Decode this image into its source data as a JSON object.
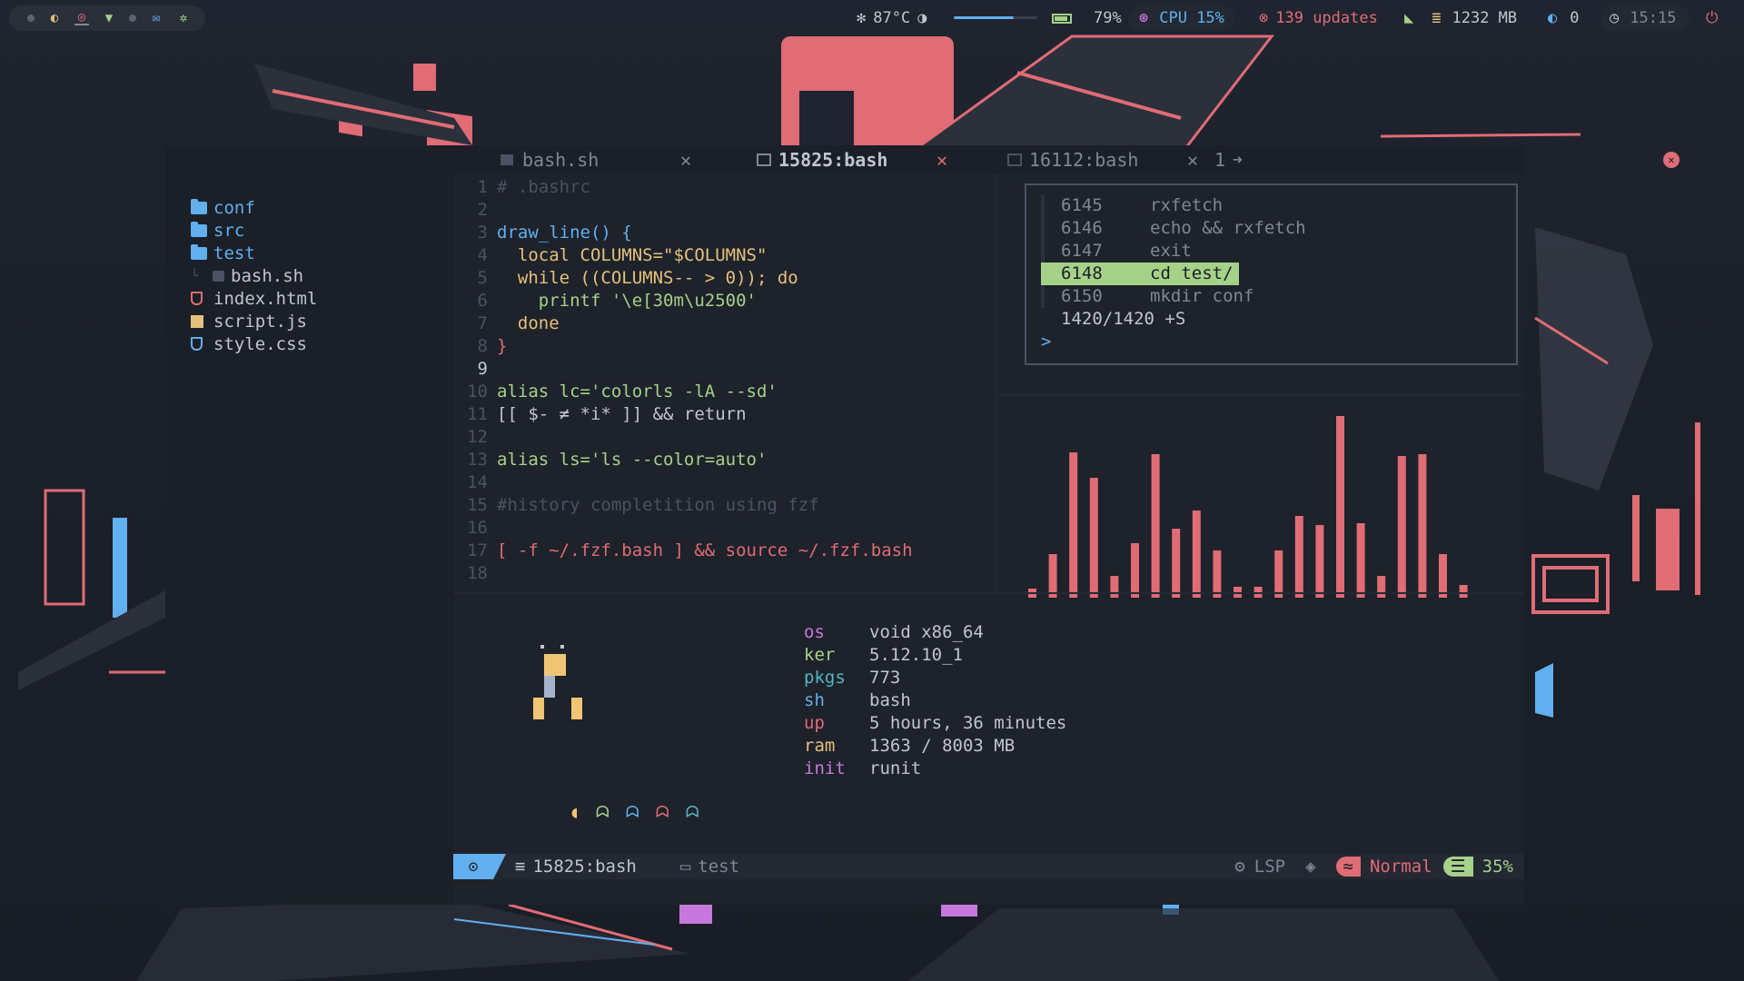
{
  "topbar": {
    "temperature": "87°C",
    "brightness": 0.72,
    "battery": "79%",
    "cpu": "CPU 15%",
    "updates": "139 updates",
    "memory": "1232 MB",
    "notifications": "0",
    "time": "15:15"
  },
  "file_tree": {
    "items": [
      {
        "label": "conf",
        "type": "folder"
      },
      {
        "label": "src",
        "type": "folder"
      },
      {
        "label": "test",
        "type": "folder"
      },
      {
        "label": "bash.sh",
        "type": "file"
      },
      {
        "label": "index.html",
        "type": "file"
      },
      {
        "label": "script.js",
        "type": "file"
      },
      {
        "label": "style.css",
        "type": "file"
      }
    ]
  },
  "tabs": [
    {
      "label": "bash.sh",
      "active": false
    },
    {
      "label": "15825:bash",
      "active": true
    },
    {
      "label": "16112:bash",
      "active": false
    }
  ],
  "tab_extra": "1",
  "editor": {
    "lines": [
      {
        "n": "1",
        "text": "# .bashrc"
      },
      {
        "n": "2",
        "text": ""
      },
      {
        "n": "3",
        "text": "draw_line() {"
      },
      {
        "n": "4",
        "text": "  local COLUMNS=\"$COLUMNS\""
      },
      {
        "n": "5",
        "text": "  while ((COLUMNS-- > 0)); do"
      },
      {
        "n": "6",
        "text": "    printf '\\e[30m\\u2500'"
      },
      {
        "n": "7",
        "text": "  done"
      },
      {
        "n": "8",
        "text": "}"
      },
      {
        "n": "9",
        "text": ""
      },
      {
        "n": "10",
        "text": "alias lc='colorls -lA --sd'"
      },
      {
        "n": "11",
        "text": "[[ $- ≠ *i* ]] && return"
      },
      {
        "n": "12",
        "text": ""
      },
      {
        "n": "13",
        "text": "alias ls='ls --color=auto'"
      },
      {
        "n": "14",
        "text": ""
      },
      {
        "n": "15",
        "text": "#history completition using fzf"
      },
      {
        "n": "16",
        "text": ""
      },
      {
        "n": "17",
        "text": "[ -f ~/.fzf.bash ] && source ~/.fzf.bash"
      },
      {
        "n": "18",
        "text": ""
      }
    ]
  },
  "fzf": {
    "history": [
      {
        "num": "6145",
        "cmd": "rxfetch",
        "selected": false
      },
      {
        "num": "6146",
        "cmd": "echo && rxfetch",
        "selected": false
      },
      {
        "num": "6147",
        "cmd": "exit",
        "selected": false
      },
      {
        "num": "6148",
        "cmd": "cd test/",
        "selected": true
      },
      {
        "num": "6150",
        "cmd": "mkdir conf",
        "selected": false
      }
    ],
    "count": "1420/1420 +S",
    "prompt": ">"
  },
  "chart_data": {
    "type": "bar",
    "values": [
      0.05,
      0.24,
      0.8,
      0.66,
      0.12,
      0.3,
      0.79,
      0.38,
      0.48,
      0.26,
      0.06,
      0.06,
      0.26,
      0.45,
      0.4,
      1.0,
      0.41,
      0.12,
      0.78,
      0.79,
      0.24,
      0.07
    ],
    "color": "#e06c75"
  },
  "fetch": {
    "info": [
      {
        "key": "os",
        "val": "void x86_64"
      },
      {
        "key": "ker",
        "val": "5.12.10_1"
      },
      {
        "key": "pkgs",
        "val": "773"
      },
      {
        "key": "sh",
        "val": "bash"
      },
      {
        "key": "up",
        "val": "5 hours, 36 minutes"
      },
      {
        "key": "ram",
        "val": "1363 / 8003 MB"
      },
      {
        "key": "init",
        "val": "runit"
      }
    ]
  },
  "statusline": {
    "session": "15825:bash",
    "dir": "test",
    "lsp": "LSP",
    "mode": "Normal",
    "percent": "35%"
  },
  "colors": {
    "accent_red": "#e06c75",
    "accent_blue": "#61afef",
    "accent_green": "#a6d189",
    "accent_yellow": "#e5c07b",
    "accent_purple": "#c678dd"
  }
}
